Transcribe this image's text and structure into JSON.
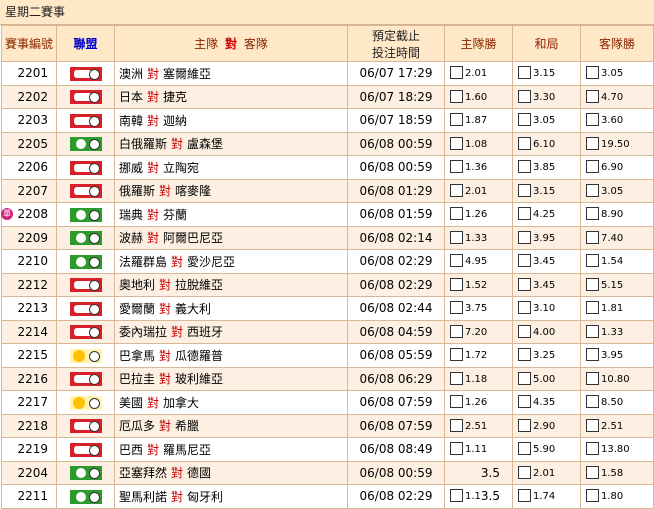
{
  "title": "星期二賽事",
  "headers": {
    "no": "賽事編號",
    "league": "聯盟",
    "match_a": "主隊",
    "match_vs": "對",
    "match_b": "客隊",
    "time_line1": "預定截止",
    "time_line2": "投注時間",
    "home": "主隊勝",
    "draw": "和局",
    "away": "客隊勝"
  },
  "vs": "對",
  "single_label": "單",
  "rows": [
    {
      "no": "2201",
      "lg": "red",
      "home": "澳洲",
      "away": "塞爾維亞",
      "time": "06/07 17:29",
      "h": "2.01",
      "d": "3.15",
      "a": "3.05"
    },
    {
      "no": "2202",
      "lg": "red",
      "home": "日本",
      "away": "捷克",
      "time": "06/07 18:29",
      "h": "1.60",
      "d": "3.30",
      "a": "4.70"
    },
    {
      "no": "2203",
      "lg": "red",
      "home": "南韓",
      "away": "迦納",
      "time": "06/07 18:59",
      "h": "1.87",
      "d": "3.05",
      "a": "3.60"
    },
    {
      "no": "2205",
      "lg": "green",
      "home": "白俄羅斯",
      "away": "盧森堡",
      "time": "06/08 00:59",
      "h": "1.08",
      "d": "6.10",
      "a": "19.50"
    },
    {
      "no": "2206",
      "lg": "red",
      "home": "挪威",
      "away": "立陶宛",
      "time": "06/08 00:59",
      "h": "1.36",
      "d": "3.85",
      "a": "6.90"
    },
    {
      "no": "2207",
      "lg": "red",
      "home": "俄羅斯",
      "away": "喀麥隆",
      "time": "06/08 01:29",
      "h": "2.01",
      "d": "3.15",
      "a": "3.05"
    },
    {
      "no": "2208",
      "lg": "green",
      "home": "瑞典",
      "away": "芬蘭",
      "time": "06/08 01:59",
      "h": "1.26",
      "d": "4.25",
      "a": "8.90",
      "single": true
    },
    {
      "no": "2209",
      "lg": "green",
      "home": "波赫",
      "away": "阿爾巴尼亞",
      "time": "06/08 02:14",
      "h": "1.33",
      "d": "3.95",
      "a": "7.40"
    },
    {
      "no": "2210",
      "lg": "green",
      "home": "法羅群島",
      "away": "愛沙尼亞",
      "time": "06/08 02:29",
      "h": "4.95",
      "d": "3.45",
      "a": "1.54"
    },
    {
      "no": "2212",
      "lg": "red",
      "home": "奧地利",
      "away": "拉脫維亞",
      "time": "06/08 02:29",
      "h": "1.52",
      "d": "3.45",
      "a": "5.15"
    },
    {
      "no": "2213",
      "lg": "red",
      "home": "愛爾蘭",
      "away": "義大利",
      "time": "06/08 02:44",
      "h": "3.75",
      "d": "3.10",
      "a": "1.81"
    },
    {
      "no": "2214",
      "lg": "red",
      "home": "委內瑞拉",
      "away": "西班牙",
      "time": "06/08 04:59",
      "h": "7.20",
      "d": "4.00",
      "a": "1.33"
    },
    {
      "no": "2215",
      "lg": "sun",
      "home": "巴拿馬",
      "away": "瓜德羅普",
      "time": "06/08 05:59",
      "h": "1.72",
      "d": "3.25",
      "a": "3.95"
    },
    {
      "no": "2216",
      "lg": "red",
      "home": "巴拉圭",
      "away": "玻利維亞",
      "time": "06/08 06:29",
      "h": "1.18",
      "d": "5.00",
      "a": "10.80"
    },
    {
      "no": "2217",
      "lg": "sun",
      "home": "美國",
      "away": "加拿大",
      "time": "06/08 07:59",
      "h": "1.26",
      "d": "4.35",
      "a": "8.50"
    },
    {
      "no": "2218",
      "lg": "red",
      "home": "厄瓜多",
      "away": "希臘",
      "time": "06/08 07:59",
      "h": "2.51",
      "d": "2.90",
      "a": "2.51"
    },
    {
      "no": "2219",
      "lg": "red",
      "home": "巴西",
      "away": "羅馬尼亞",
      "time": "06/08 08:49",
      "h": "1.11",
      "d": "5.90",
      "a": "13.80"
    },
    {
      "no": "2204",
      "lg": "green",
      "home": "亞塞拜然",
      "away": "德國",
      "time": "06/08 00:59",
      "hcp": "3.5",
      "d": "2.01",
      "a": "1.58"
    },
    {
      "no": "2211",
      "lg": "green",
      "home": "聖馬利諾",
      "away": "匈牙利",
      "time": "06/08 02:29",
      "hcp": "3.5",
      "h": "1.1",
      "d": "1.74",
      "a": "1.80"
    }
  ]
}
